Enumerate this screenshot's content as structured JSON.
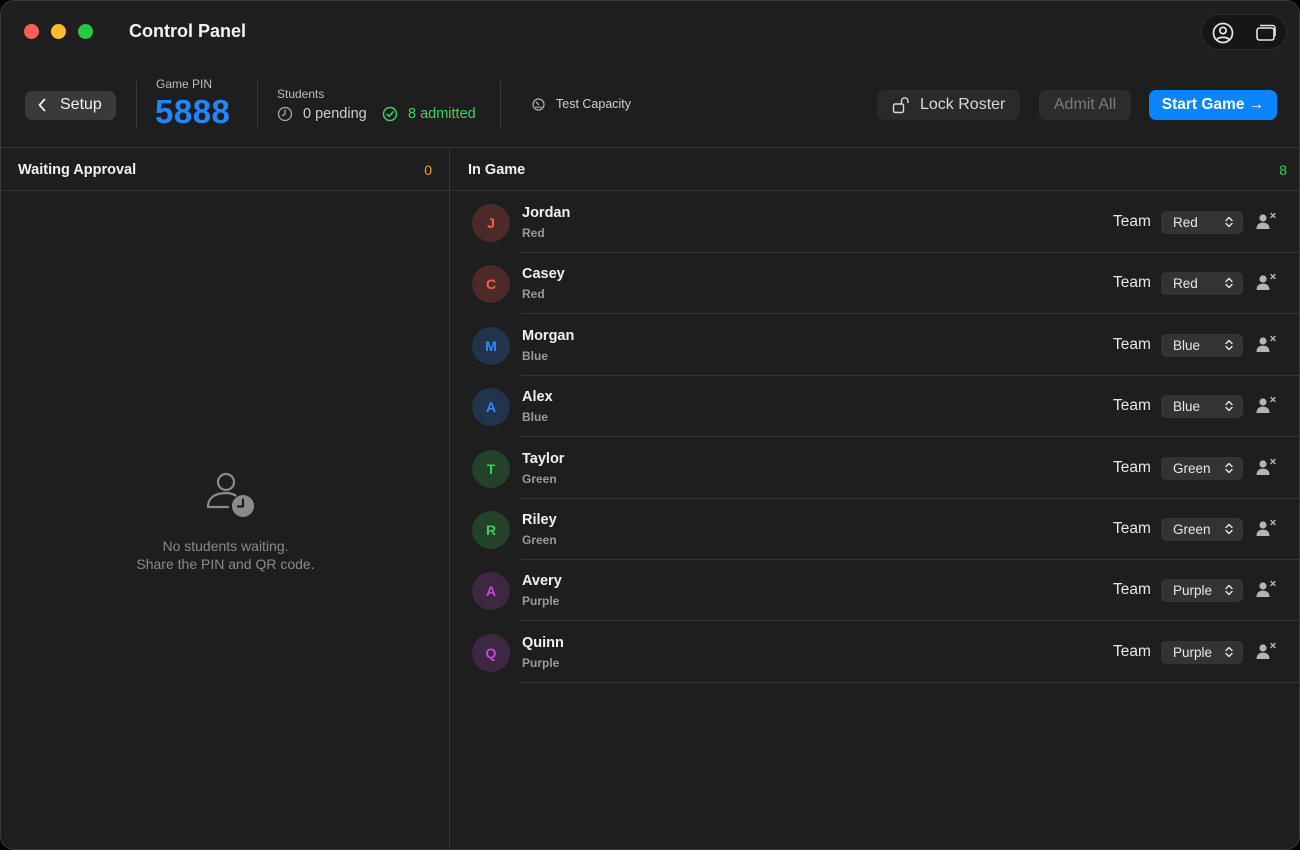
{
  "window": {
    "title": "Control Panel"
  },
  "toolbar": {
    "setup_label": "Setup",
    "game_pin_label": "Game PIN",
    "game_pin_value": "5888",
    "students_label": "Students",
    "pending_text": "0 pending",
    "admitted_text": "8 admitted",
    "test_capacity_label": "Test Capacity",
    "lock_roster_label": "Lock Roster",
    "admit_all_label": "Admit All",
    "start_game_label": "Start Game →"
  },
  "waiting": {
    "title": "Waiting Approval",
    "count": "0",
    "empty_line1": "No students waiting.",
    "empty_line2": "Share the PIN and QR code."
  },
  "ingame": {
    "title": "In Game",
    "count": "8",
    "team_label": "Team",
    "players": [
      {
        "initial": "J",
        "name": "Jordan",
        "team": "Red"
      },
      {
        "initial": "C",
        "name": "Casey",
        "team": "Red"
      },
      {
        "initial": "M",
        "name": "Morgan",
        "team": "Blue"
      },
      {
        "initial": "A",
        "name": "Alex",
        "team": "Blue"
      },
      {
        "initial": "T",
        "name": "Taylor",
        "team": "Green"
      },
      {
        "initial": "R",
        "name": "Riley",
        "team": "Green"
      },
      {
        "initial": "A",
        "name": "Avery",
        "team": "Purple"
      },
      {
        "initial": "Q",
        "name": "Quinn",
        "team": "Purple"
      }
    ]
  },
  "colors": {
    "accent": "#0b84ff",
    "pin": "#1e87ff",
    "admitted": "#3fd164",
    "waiting_count": "#ff9f0a",
    "ingame_count": "#32d74b",
    "team_red": "#ff5a52",
    "team_blue": "#2f8cff",
    "team_green": "#3ccf5c",
    "team_purple": "#c04ad9"
  }
}
